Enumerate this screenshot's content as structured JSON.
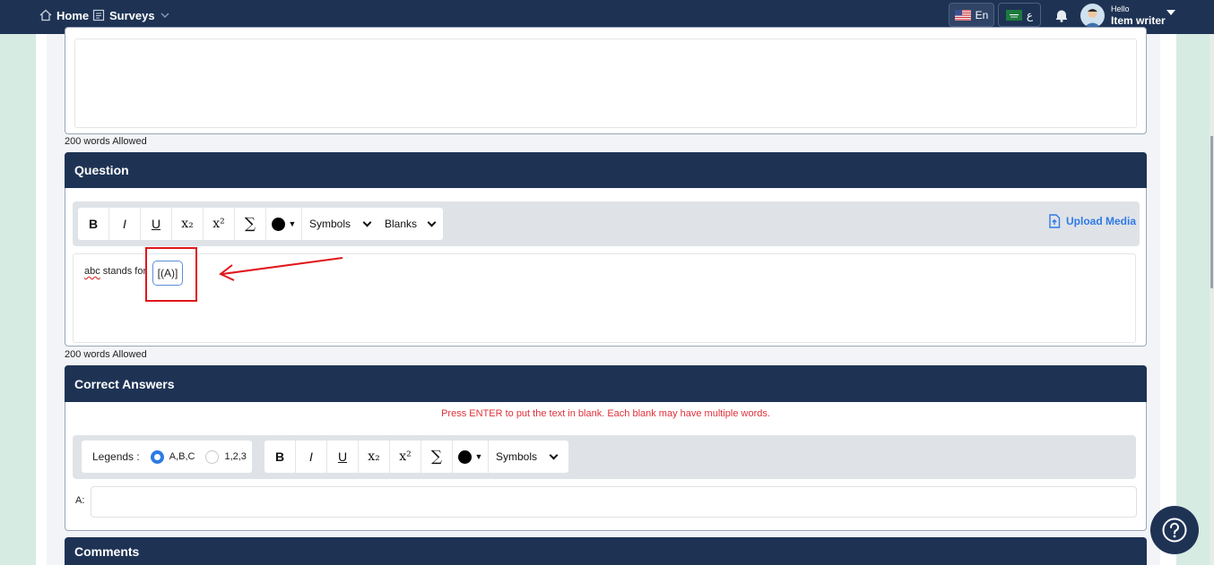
{
  "nav": {
    "home_label": "Home",
    "surveys_label": "Surveys",
    "lang_en_label": "En",
    "lang_ar_label": "ع",
    "greeting": "Hello",
    "user_name": "Item writer"
  },
  "top_editor": {
    "word_limit_note": "200 words Allowed"
  },
  "question": {
    "header": "Question",
    "toolbar": {
      "bold": "B",
      "italic": "I",
      "underline": "U",
      "subscript": "x₂",
      "superscript": "x²",
      "sum": "∑",
      "symbols_label": "Symbols",
      "blanks_label": "Blanks"
    },
    "upload_label": "Upload Media",
    "text_misspelled": "abc",
    "text_rest": " stands for",
    "blank_chip": "[(A)]",
    "word_limit_note": "200 words Allowed"
  },
  "correct_answers": {
    "header": "Correct Answers",
    "instruction": "Press ENTER to put the text in blank. Each blank may have multiple words.",
    "legends_label": "Legends :",
    "legend_options": [
      "A,B,C",
      "1,2,3"
    ],
    "legend_selected": "A,B,C",
    "toolbar": {
      "bold": "B",
      "italic": "I",
      "underline": "U",
      "subscript": "x₂",
      "superscript": "x²",
      "sum": "∑",
      "symbols_label": "Symbols"
    },
    "answer_label": "A:",
    "answer_value": ""
  },
  "comments": {
    "header": "Comments"
  },
  "colors": {
    "navy": "#1e3354",
    "accent_blue": "#2f7ae5",
    "annotation_red": "#e0161b",
    "instruction_red": "#e0313a"
  }
}
